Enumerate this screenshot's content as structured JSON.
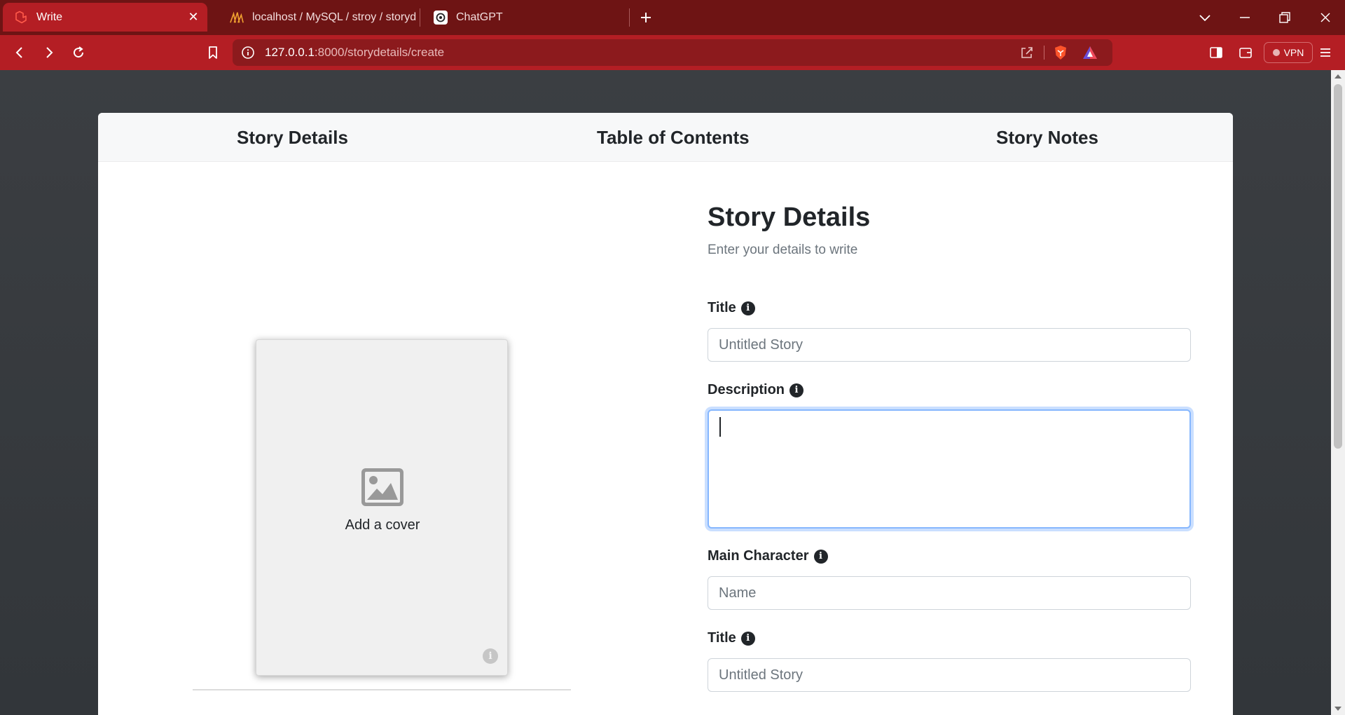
{
  "browser": {
    "tabs": [
      {
        "title": "Write",
        "active": true,
        "icon": "laravel-icon"
      },
      {
        "title": "localhost / MySQL / stroy / storydeta",
        "active": false,
        "icon": "phpmyadmin-icon"
      },
      {
        "title": "ChatGPT",
        "active": false,
        "icon": "chatgpt-icon"
      }
    ],
    "url_host": "127.0.0.1",
    "url_path": ":8000/storydetails/create",
    "vpn_label": "VPN",
    "colors": {
      "tabbar": "#6e1414",
      "toolbar": "#b41e24",
      "omnibox": "#8c1a1d"
    }
  },
  "page": {
    "nav_tabs": [
      "Story Details",
      "Table of Contents",
      "Story Notes"
    ],
    "cover": {
      "label": "Add a cover",
      "info": "i"
    },
    "form": {
      "heading": "Story Details",
      "subheading": "Enter your details to write",
      "fields": [
        {
          "label": "Title",
          "placeholder": "Untitled Story",
          "value": ""
        },
        {
          "label": "Description",
          "value": ""
        },
        {
          "label": "Main Character",
          "placeholder": "Name",
          "value": ""
        },
        {
          "label": "Title",
          "placeholder": "Untitled Story",
          "value": ""
        }
      ]
    },
    "colors": {
      "background": "#3a3d41",
      "card": "#ffffff",
      "focus_ring": "#86b7fe"
    }
  }
}
